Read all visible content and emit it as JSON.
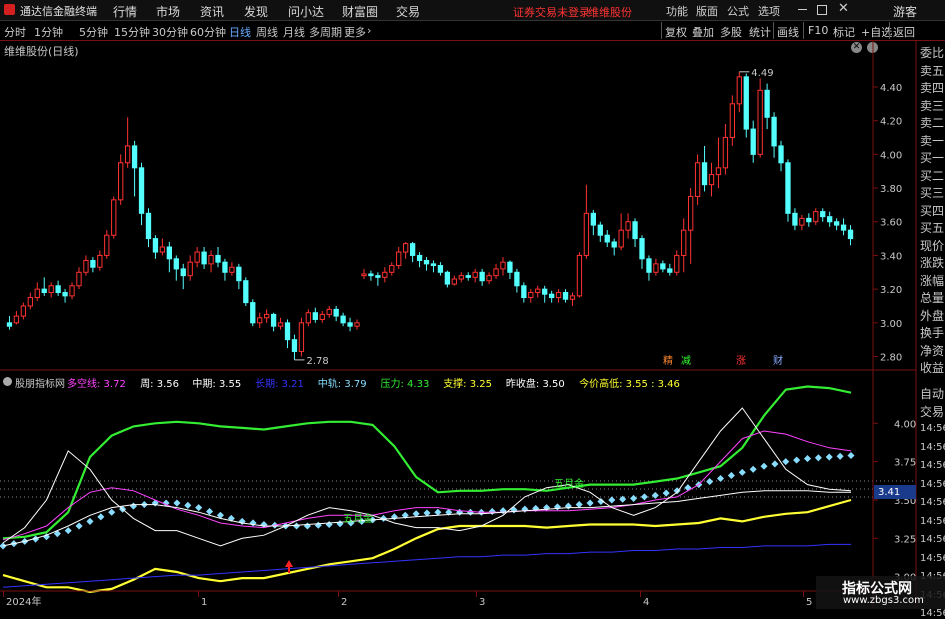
{
  "app": {
    "title": "通达信金融终端"
  },
  "menu": [
    "行情",
    "市场",
    "资讯",
    "发现",
    "问小达",
    "财富圈",
    "交易"
  ],
  "notice": {
    "login": "证券交易未登录",
    "stock": "维维股份"
  },
  "top_right": [
    "功能",
    "版面",
    "公式",
    "选项"
  ],
  "guest": "游客",
  "periods": [
    "分时",
    "1分钟",
    "5分钟",
    "15分钟",
    "30分钟",
    "60分钟",
    "日线",
    "周线",
    "月线",
    "多周期",
    "更多"
  ],
  "active_period": "日线",
  "right_tools": [
    "复权",
    "叠加",
    "多股",
    "统计",
    "画线",
    "F10",
    "标记",
    "+自选",
    "返回"
  ],
  "chart_label": "维维股份(日线)",
  "right_panel": [
    "委比",
    "卖五",
    "卖四",
    "卖三",
    "卖二",
    "卖一",
    "买一",
    "买二",
    "买三",
    "买四",
    "买五",
    "现价",
    "涨跌",
    "涨幅",
    "总量",
    "外盘",
    "换手",
    "净资",
    "收益"
  ],
  "right_panel2": [
    "自动",
    "交易"
  ],
  "time_values": [
    "14:56",
    "14:56",
    "14:56",
    "14:56",
    "14:56",
    "14:56",
    "14:56",
    "14:56",
    "14:56",
    "14:56",
    "14:56"
  ],
  "indicator": {
    "name": "股朋指标网",
    "items": [
      {
        "label": "多空线:",
        "value": "3.72",
        "color": "#ff44ff"
      },
      {
        "label": "周:",
        "value": "3.56",
        "color": "#ffffff"
      },
      {
        "label": "中期:",
        "value": "3.55",
        "color": "#ffffff"
      },
      {
        "label": "长期:",
        "value": "3.21",
        "color": "#3333ff"
      },
      {
        "label": "中轨:",
        "value": "3.79",
        "color": "#88ddff"
      },
      {
        "label": "压力:",
        "value": "4.33",
        "color": "#33ee33"
      },
      {
        "label": "支撑:",
        "value": "3.25",
        "color": "#ffff33"
      },
      {
        "label": "昨收盘:",
        "value": "3.50",
        "color": "#ffffff"
      },
      {
        "label": "今价高低:",
        "value": "3.55 : 3.46",
        "color": "#ffff33"
      }
    ]
  },
  "annotations": {
    "high": "4.49",
    "low": "2.78",
    "buy1": "五月金",
    "buy2": "五月金",
    "current": "3.41"
  },
  "signals": [
    "精",
    "减",
    "涨",
    "财"
  ],
  "x_labels": [
    "2024年",
    "1",
    "2",
    "3",
    "4",
    "5"
  ],
  "watermark": {
    "name": "指标公式网",
    "url": "www.zbgs3.com"
  },
  "chart_data": [
    {
      "type": "candlestick",
      "title": "维维股份(日线)",
      "y_ticks": [
        2.8,
        3.0,
        3.2,
        3.4,
        3.6,
        3.8,
        4.0,
        4.2,
        4.4
      ],
      "ylim": [
        2.72,
        4.56
      ],
      "grid": false,
      "candles": [
        [
          3.0,
          2.98,
          3.04,
          2.96
        ],
        [
          3.0,
          3.04,
          3.07,
          2.99
        ],
        [
          3.04,
          3.1,
          3.12,
          3.02
        ],
        [
          3.1,
          3.15,
          3.18,
          3.08
        ],
        [
          3.15,
          3.2,
          3.24,
          3.13
        ],
        [
          3.2,
          3.18,
          3.27,
          3.16
        ],
        [
          3.18,
          3.22,
          3.24,
          3.15
        ],
        [
          3.22,
          3.18,
          3.25,
          3.16
        ],
        [
          3.18,
          3.16,
          3.2,
          3.12
        ],
        [
          3.16,
          3.22,
          3.24,
          3.14
        ],
        [
          3.22,
          3.3,
          3.33,
          3.2
        ],
        [
          3.3,
          3.37,
          3.4,
          3.28
        ],
        [
          3.37,
          3.33,
          3.39,
          3.3
        ],
        [
          3.33,
          3.4,
          3.43,
          3.31
        ],
        [
          3.4,
          3.52,
          3.55,
          3.38
        ],
        [
          3.52,
          3.73,
          3.75,
          3.5
        ],
        [
          3.73,
          3.95,
          4.0,
          3.7
        ],
        [
          3.95,
          4.05,
          4.22,
          3.92
        ],
        [
          4.05,
          3.92,
          4.08,
          3.75
        ],
        [
          3.92,
          3.65,
          3.95,
          3.58
        ],
        [
          3.65,
          3.5,
          3.68,
          3.45
        ],
        [
          3.5,
          3.42,
          3.52,
          3.38
        ],
        [
          3.42,
          3.45,
          3.5,
          3.4
        ],
        [
          3.45,
          3.38,
          3.48,
          3.3
        ],
        [
          3.38,
          3.32,
          3.4,
          3.25
        ],
        [
          3.32,
          3.28,
          3.35,
          3.2
        ],
        [
          3.28,
          3.36,
          3.4,
          3.25
        ],
        [
          3.36,
          3.42,
          3.45,
          3.33
        ],
        [
          3.42,
          3.35,
          3.45,
          3.32
        ],
        [
          3.35,
          3.4,
          3.43,
          3.3
        ],
        [
          3.4,
          3.36,
          3.45,
          3.33
        ],
        [
          3.36,
          3.3,
          3.38,
          3.25
        ],
        [
          3.3,
          3.33,
          3.36,
          3.28
        ],
        [
          3.33,
          3.25,
          3.35,
          3.2
        ],
        [
          3.25,
          3.12,
          3.27,
          3.1
        ],
        [
          3.12,
          3.0,
          3.14,
          2.98
        ],
        [
          3.0,
          3.03,
          3.06,
          2.97
        ],
        [
          3.03,
          3.05,
          3.08,
          3.0
        ],
        [
          3.05,
          2.98,
          3.06,
          2.95
        ],
        [
          2.98,
          3.0,
          3.03,
          2.96
        ],
        [
          3.0,
          2.9,
          3.02,
          2.85
        ],
        [
          2.9,
          2.83,
          2.93,
          2.78
        ],
        [
          2.83,
          3.0,
          3.03,
          2.8
        ],
        [
          3.0,
          3.06,
          3.08,
          2.98
        ],
        [
          3.06,
          3.02,
          3.09,
          3.0
        ],
        [
          3.02,
          3.05,
          3.07,
          3.0
        ],
        [
          3.05,
          3.08,
          3.1,
          3.03
        ],
        [
          3.08,
          3.04,
          3.1,
          3.01
        ],
        [
          3.04,
          3.0,
          3.06,
          2.98
        ],
        [
          3.0,
          2.98,
          3.03,
          2.95
        ],
        [
          2.98,
          3.0,
          3.02,
          2.96
        ],
        [
          3.28,
          3.29,
          3.32,
          3.26
        ],
        [
          3.29,
          3.28,
          3.31,
          3.25
        ],
        [
          3.28,
          3.27,
          3.3,
          3.22
        ],
        [
          3.27,
          3.3,
          3.33,
          3.24
        ],
        [
          3.3,
          3.34,
          3.36,
          3.28
        ],
        [
          3.34,
          3.42,
          3.45,
          3.32
        ],
        [
          3.42,
          3.47,
          3.48,
          3.38
        ],
        [
          3.47,
          3.4,
          3.48,
          3.36
        ],
        [
          3.4,
          3.37,
          3.42,
          3.33
        ],
        [
          3.37,
          3.35,
          3.39,
          3.31
        ],
        [
          3.35,
          3.34,
          3.37,
          3.3
        ],
        [
          3.34,
          3.3,
          3.36,
          3.28
        ],
        [
          3.3,
          3.23,
          3.31,
          3.21
        ],
        [
          3.23,
          3.26,
          3.28,
          3.22
        ],
        [
          3.26,
          3.28,
          3.3,
          3.24
        ],
        [
          3.28,
          3.27,
          3.3,
          3.25
        ],
        [
          3.27,
          3.3,
          3.32,
          3.24
        ],
        [
          3.3,
          3.25,
          3.32,
          3.22
        ],
        [
          3.25,
          3.28,
          3.3,
          3.23
        ],
        [
          3.28,
          3.32,
          3.35,
          3.26
        ],
        [
          3.32,
          3.36,
          3.39,
          3.28
        ],
        [
          3.36,
          3.3,
          3.37,
          3.26
        ],
        [
          3.3,
          3.22,
          3.32,
          3.18
        ],
        [
          3.22,
          3.15,
          3.24,
          3.12
        ],
        [
          3.15,
          3.18,
          3.2,
          3.12
        ],
        [
          3.18,
          3.2,
          3.22,
          3.15
        ],
        [
          3.2,
          3.17,
          3.22,
          3.12
        ],
        [
          3.17,
          3.15,
          3.19,
          3.12
        ],
        [
          3.15,
          3.18,
          3.2,
          3.12
        ],
        [
          3.18,
          3.14,
          3.2,
          3.12
        ],
        [
          3.14,
          3.16,
          3.18,
          3.1
        ],
        [
          3.16,
          3.4,
          3.42,
          3.15
        ],
        [
          3.4,
          3.65,
          3.82,
          3.38
        ],
        [
          3.65,
          3.58,
          3.67,
          3.52
        ],
        [
          3.58,
          3.52,
          3.6,
          3.48
        ],
        [
          3.52,
          3.48,
          3.55,
          3.45
        ],
        [
          3.48,
          3.45,
          3.5,
          3.4
        ],
        [
          3.45,
          3.55,
          3.65,
          3.43
        ],
        [
          3.55,
          3.6,
          3.65,
          3.5
        ],
        [
          3.6,
          3.5,
          3.62,
          3.45
        ],
        [
          3.5,
          3.38,
          3.52,
          3.32
        ],
        [
          3.38,
          3.3,
          3.4,
          3.25
        ],
        [
          3.3,
          3.35,
          3.38,
          3.28
        ],
        [
          3.35,
          3.32,
          3.37,
          3.3
        ],
        [
          3.32,
          3.3,
          3.35,
          3.28
        ],
        [
          3.3,
          3.4,
          3.43,
          3.28
        ],
        [
          3.4,
          3.55,
          3.62,
          3.3
        ],
        [
          3.55,
          3.75,
          3.8,
          3.35
        ],
        [
          3.75,
          3.95,
          4.0,
          3.7
        ],
        [
          3.95,
          3.82,
          4.05,
          3.78
        ],
        [
          3.82,
          3.88,
          3.95,
          3.75
        ],
        [
          3.88,
          3.92,
          4.1,
          3.8
        ],
        [
          3.92,
          4.1,
          4.18,
          3.88
        ],
        [
          4.1,
          4.3,
          4.35,
          4.05
        ],
        [
          4.3,
          4.46,
          4.49,
          4.25
        ],
        [
          4.46,
          4.15,
          4.48,
          4.1
        ],
        [
          4.15,
          4.0,
          4.2,
          3.95
        ],
        [
          4.0,
          4.38,
          4.45,
          3.98
        ],
        [
          4.38,
          4.22,
          4.42,
          4.15
        ],
        [
          4.22,
          4.05,
          4.25,
          3.98
        ],
        [
          4.05,
          3.95,
          4.08,
          3.9
        ],
        [
          3.95,
          3.65,
          3.97,
          3.6
        ],
        [
          3.65,
          3.58,
          3.68,
          3.55
        ],
        [
          3.58,
          3.62,
          3.64,
          3.55
        ],
        [
          3.62,
          3.6,
          3.65,
          3.57
        ],
        [
          3.6,
          3.66,
          3.68,
          3.58
        ],
        [
          3.66,
          3.63,
          3.68,
          3.6
        ],
        [
          3.63,
          3.6,
          3.66,
          3.57
        ],
        [
          3.6,
          3.58,
          3.62,
          3.55
        ],
        [
          3.58,
          3.55,
          3.62,
          3.52
        ],
        [
          3.55,
          3.5,
          3.58,
          3.46
        ]
      ]
    },
    {
      "type": "line",
      "title": "股朋指标网",
      "y_ticks": [
        3.0,
        3.25,
        3.5,
        3.75,
        4.0
      ],
      "ylim": [
        2.88,
        4.25
      ],
      "series": [
        {
          "name": "压力",
          "color": "#33ee33",
          "values": [
            3.25,
            3.26,
            3.29,
            3.42,
            3.78,
            3.92,
            3.98,
            4.0,
            4.01,
            4.0,
            3.98,
            3.97,
            3.96,
            3.98,
            4.0,
            4.01,
            4.01,
            3.99,
            3.85,
            3.65,
            3.55,
            3.56,
            3.56,
            3.57,
            3.57,
            3.56,
            3.58,
            3.6,
            3.6,
            3.6,
            3.62,
            3.64,
            3.68,
            3.72,
            3.84,
            4.05,
            4.22,
            4.24,
            4.23,
            4.2
          ]
        },
        {
          "name": "支撑",
          "color": "#ffff33",
          "values": [
            3.01,
            2.97,
            2.93,
            2.93,
            2.9,
            2.92,
            2.98,
            3.05,
            3.03,
            2.99,
            2.97,
            2.99,
            2.99,
            3.02,
            3.05,
            3.08,
            3.1,
            3.12,
            3.18,
            3.25,
            3.31,
            3.33,
            3.33,
            3.33,
            3.33,
            3.32,
            3.33,
            3.34,
            3.34,
            3.34,
            3.33,
            3.34,
            3.35,
            3.38,
            3.36,
            3.39,
            3.41,
            3.42,
            3.46,
            3.5
          ]
        },
        {
          "name": "中轨",
          "color": "#88ddff",
          "values": [
            3.2,
            3.23,
            3.26,
            3.3,
            3.36,
            3.42,
            3.46,
            3.48,
            3.48,
            3.45,
            3.4,
            3.36,
            3.34,
            3.33,
            3.33,
            3.34,
            3.35,
            3.37,
            3.39,
            3.41,
            3.42,
            3.42,
            3.42,
            3.43,
            3.44,
            3.45,
            3.46,
            3.48,
            3.5,
            3.51,
            3.53,
            3.56,
            3.6,
            3.64,
            3.68,
            3.72,
            3.75,
            3.77,
            3.78,
            3.79
          ]
        },
        {
          "name": "多空线",
          "color": "#ff44ff",
          "values": [
            3.24,
            3.28,
            3.33,
            3.45,
            3.55,
            3.58,
            3.56,
            3.5,
            3.44,
            3.4,
            3.35,
            3.33,
            3.32,
            3.35,
            3.38,
            3.4,
            3.4,
            3.4,
            3.43,
            3.45,
            3.45,
            3.43,
            3.42,
            3.42,
            3.43,
            3.43,
            3.43,
            3.44,
            3.45,
            3.47,
            3.5,
            3.52,
            3.6,
            3.75,
            3.9,
            3.95,
            3.93,
            3.88,
            3.84,
            3.82
          ]
        },
        {
          "name": "周",
          "color": "#ffffff",
          "values": [
            3.22,
            3.32,
            3.5,
            3.82,
            3.7,
            3.5,
            3.38,
            3.3,
            3.3,
            3.25,
            3.2,
            3.25,
            3.27,
            3.33,
            3.4,
            3.45,
            3.43,
            3.4,
            3.35,
            3.32,
            3.32,
            3.3,
            3.33,
            3.4,
            3.52,
            3.58,
            3.6,
            3.55,
            3.45,
            3.4,
            3.45,
            3.55,
            3.75,
            3.95,
            4.1,
            3.9,
            3.7,
            3.6,
            3.57,
            3.56
          ]
        },
        {
          "name": "中期",
          "color": "#ffffff",
          "values": [
            3.2,
            3.23,
            3.27,
            3.33,
            3.4,
            3.45,
            3.47,
            3.47,
            3.45,
            3.42,
            3.38,
            3.35,
            3.33,
            3.33,
            3.34,
            3.35,
            3.36,
            3.37,
            3.38,
            3.39,
            3.4,
            3.41,
            3.41,
            3.42,
            3.43,
            3.44,
            3.45,
            3.45,
            3.46,
            3.47,
            3.48,
            3.49,
            3.51,
            3.53,
            3.55,
            3.56,
            3.56,
            3.56,
            3.55,
            3.55
          ]
        },
        {
          "name": "长期",
          "color": "#3333ff",
          "values": [
            2.93,
            2.94,
            2.95,
            2.96,
            2.97,
            2.98,
            2.99,
            3.0,
            3.01,
            3.01,
            3.02,
            3.03,
            3.04,
            3.05,
            3.06,
            3.07,
            3.08,
            3.09,
            3.1,
            3.11,
            3.12,
            3.13,
            3.13,
            3.14,
            3.14,
            3.15,
            3.15,
            3.16,
            3.16,
            3.17,
            3.17,
            3.18,
            3.18,
            3.19,
            3.19,
            3.2,
            3.2,
            3.2,
            3.21,
            3.21
          ]
        }
      ]
    }
  ]
}
